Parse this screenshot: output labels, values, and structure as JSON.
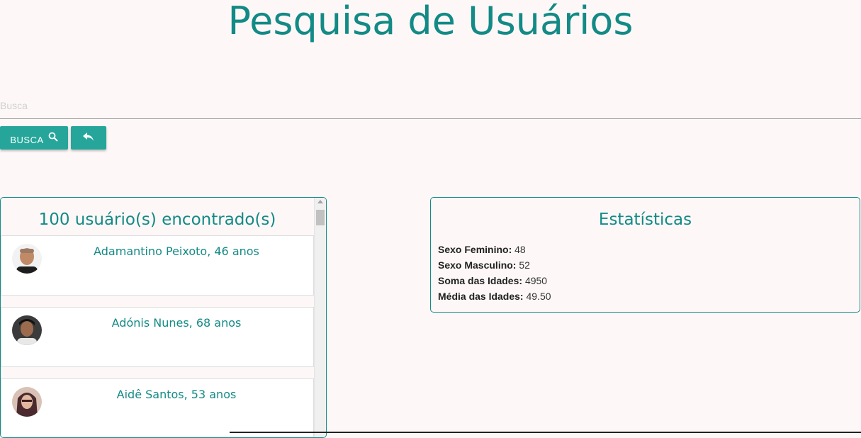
{
  "page": {
    "title": "Pesquisa de Usuários"
  },
  "search": {
    "placeholder": "Busca",
    "value": "",
    "button_label": "BUSCA",
    "button_icon": "search-icon",
    "back_icon": "reply-icon"
  },
  "colors": {
    "accent": "#138a86",
    "button": "#26a69a",
    "background": "#fdf8f7"
  },
  "users": {
    "count_text": "100 usuário(s) encontrado(s)",
    "items": [
      {
        "name": "Adamantino Peixoto, 46 anos",
        "avatar": "user-photo"
      },
      {
        "name": "Adónis Nunes, 68 anos",
        "avatar": "user-photo"
      },
      {
        "name": "Aidê Santos, 53 anos",
        "avatar": "user-photo"
      }
    ]
  },
  "stats": {
    "title": "Estatísticas",
    "rows": [
      {
        "label": "Sexo Feminino:",
        "value": "48"
      },
      {
        "label": "Sexo Masculino:",
        "value": "52"
      },
      {
        "label": "Soma das Idades:",
        "value": "4950"
      },
      {
        "label": "Média das Idades:",
        "value": "49.50"
      }
    ]
  }
}
